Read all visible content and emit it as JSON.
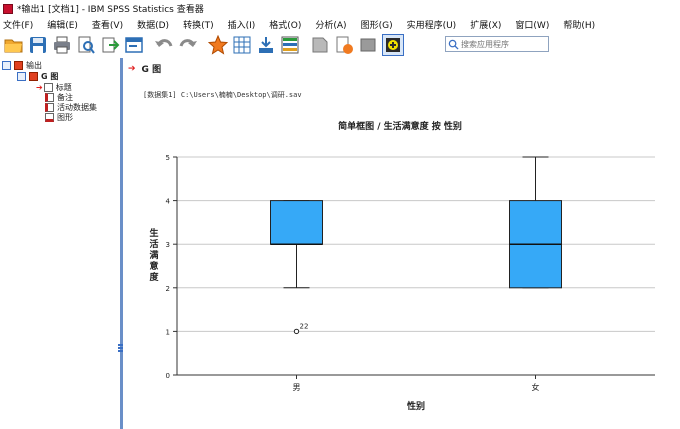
{
  "window": {
    "title": "*输出1 [文档1] - IBM SPSS Statistics 查看器"
  },
  "menu": [
    "文件(F)",
    "编辑(E)",
    "查看(V)",
    "数据(D)",
    "转换(T)",
    "插入(I)",
    "格式(O)",
    "分析(A)",
    "图形(G)",
    "实用程序(U)",
    "扩展(X)",
    "窗口(W)",
    "帮助(H)"
  ],
  "toolbar": {
    "icons": [
      "open-folder-icon",
      "save-icon",
      "print-icon",
      "print-preview-icon",
      "export-icon",
      "dialog-recall-icon",
      "undo-icon",
      "redo-icon",
      "goto-data-icon",
      "goto-case-icon",
      "variables-icon",
      "value-labels-icon",
      "promote-icon",
      "demote-icon",
      "hide-icon",
      "insert-new-icon"
    ],
    "search_placeholder": "搜索应用程序"
  },
  "outline": {
    "root": "输出",
    "node": "G 图",
    "children": [
      "标题",
      "备注",
      "活动数据集",
      "图形"
    ]
  },
  "content": {
    "heading": "G 图",
    "dataset_line": "[数据集1]  C:\\Users\\楠楠\\Desktop\\调研.sav"
  },
  "colors": {
    "box_fill": "#36a9f7",
    "accent": "#3a6fc4",
    "arrow": "#e02020"
  },
  "chart_data": {
    "type": "boxplot",
    "title": "简单框图 / 生活满意度 按 性别",
    "xlabel": "性别",
    "ylabel": "生活满意度",
    "ylim": [
      0,
      5
    ],
    "yticks": [
      0,
      1,
      2,
      3,
      4,
      5
    ],
    "grid": true,
    "categories": [
      "男",
      "女"
    ],
    "boxes": [
      {
        "category": "男",
        "min": 2,
        "q1": 3,
        "median": 3,
        "q3": 4,
        "max": 4,
        "outliers": [
          {
            "value": 1,
            "label": "22"
          }
        ]
      },
      {
        "category": "女",
        "min": 2,
        "q1": 2,
        "median": 3,
        "q3": 4,
        "max": 5,
        "outliers": []
      }
    ]
  }
}
